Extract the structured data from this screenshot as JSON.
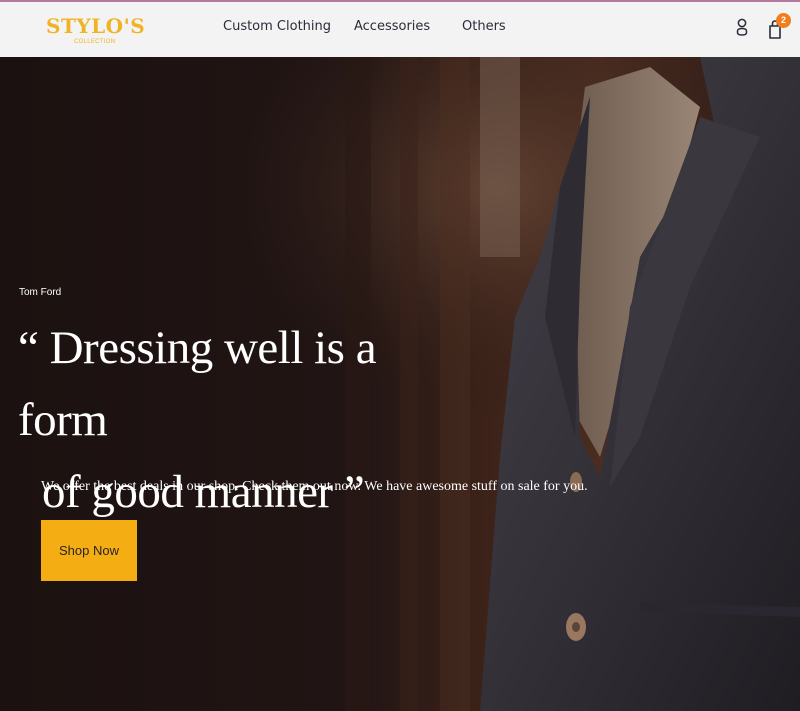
{
  "brand": {
    "name": "STYLO'S",
    "sub": "COLLECTION",
    "color": "#f0b323"
  },
  "nav": {
    "items": [
      {
        "label": "Custom Clothing"
      },
      {
        "label": "Accessories"
      },
      {
        "label": "Others"
      }
    ]
  },
  "header_icons": {
    "user": "user-icon",
    "cart": "shopping-bag-icon",
    "cart_count": "2",
    "badge_color": "#f27d1c"
  },
  "hero": {
    "author": "Tom Ford",
    "headline_line1": "“ Dressing well is a form",
    "headline_line2": "of good manner ”",
    "tagline": "We offer the best deals in our shop. Check them out now. We have awesome stuff on sale for you.",
    "cta_label": "Shop Now",
    "cta_color": "#f4ae14"
  }
}
